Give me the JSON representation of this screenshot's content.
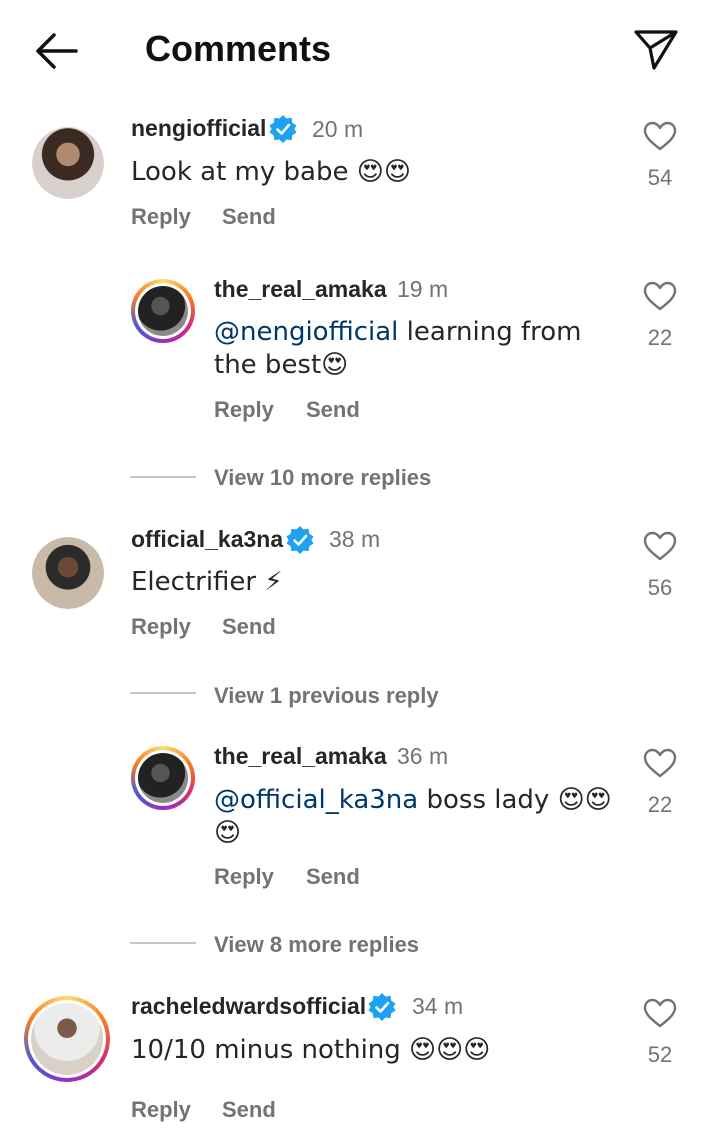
{
  "header": {
    "title": "Comments"
  },
  "actions": {
    "reply": "Reply",
    "send": "Send"
  },
  "comments": [
    {
      "username": "nengiofficial",
      "time": "20 m",
      "text": "Look at my babe 😍😍",
      "likes": "54"
    },
    {
      "username": "the_real_amaka",
      "time": "19 m",
      "mention": "@nengiofficial",
      "text": " learning from the best😍",
      "likes": "22"
    },
    {
      "view_more": "View 10 more replies"
    },
    {
      "username": "official_ka3na",
      "time": "38 m",
      "text": "Electrifier ⚡",
      "likes": "56"
    },
    {
      "view_more": "View 1 previous reply"
    },
    {
      "username": "the_real_amaka",
      "time": "36 m",
      "mention": "@official_ka3na",
      "text": " boss lady 😍😍😍",
      "likes": "22"
    },
    {
      "view_more": "View 8 more replies"
    },
    {
      "username": "racheledwardsofficial",
      "time": "34 m",
      "text": "10/10 minus nothing 😍😍😍",
      "likes": "52"
    }
  ],
  "colors": {
    "verified": "#1da1f2",
    "mention": "#00376b",
    "muted": "#737373"
  }
}
